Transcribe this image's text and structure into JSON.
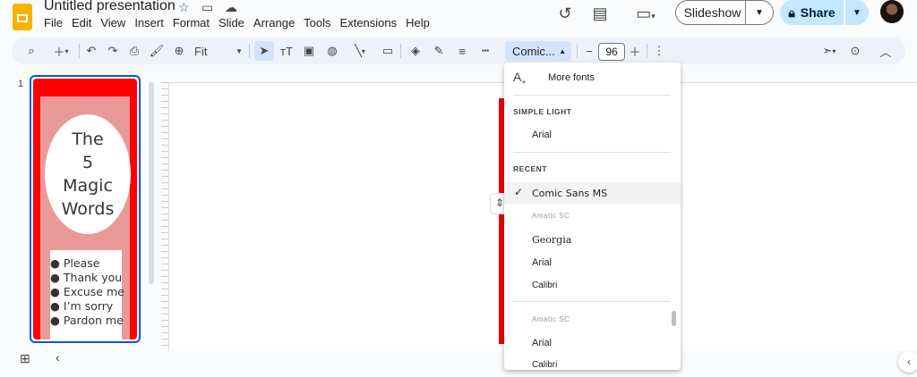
{
  "doc": {
    "title": "Untitled presentation"
  },
  "menu": [
    "File",
    "Edit",
    "View",
    "Insert",
    "Format",
    "Slide",
    "Arrange",
    "Tools",
    "Extensions",
    "Help"
  ],
  "buttons": {
    "slideshow": "Slideshow",
    "share": "Share"
  },
  "toolbar": {
    "zoom": "Fit",
    "font": "Comic...",
    "font_size": "96"
  },
  "filmstrip": {
    "slide_number": "1",
    "title_lines": [
      "The",
      "5",
      "Magic",
      "Words"
    ],
    "bullets": [
      "Please",
      "Thank you",
      "Excuse me",
      "I’m sorry",
      "Pardon me"
    ]
  },
  "font_menu": {
    "more_fonts": "More fonts",
    "section_theme": "SIMPLE LIGHT",
    "theme_fonts": [
      "Arial"
    ],
    "section_recent": "RECENT",
    "selected": "Comic Sans MS",
    "recent_fonts": [
      "Amatic SC",
      "Georgia",
      "Arial",
      "Calibri"
    ],
    "all_fonts": [
      "Amatic SC",
      "Arial",
      "Calibri"
    ]
  },
  "colors": {
    "accent": "#0b57d0",
    "share_bg": "#c2e7ff",
    "slide_red": "#ff0000",
    "slide_pink": "#ea9999",
    "toolbar_bg": "#edf2fa"
  },
  "icons": [
    "star-icon",
    "move-folder-icon",
    "cloud-icon",
    "history-icon",
    "comment-icon",
    "video-call-icon",
    "lock-icon",
    "search-icon",
    "add-icon",
    "undo-icon",
    "redo-icon",
    "print-icon",
    "paint-format-icon",
    "zoom-icon",
    "cursor-icon",
    "text-box-icon",
    "image-icon",
    "shape-icon",
    "line-icon",
    "video-icon",
    "fill-icon",
    "border-color-icon",
    "border-weight-icon",
    "border-dash-icon",
    "minus-icon",
    "plus-icon",
    "more-icon",
    "pointer-icon",
    "play-icon",
    "collapse-icon",
    "grid-icon",
    "chevron-left-icon",
    "check-icon",
    "add-font-icon"
  ]
}
